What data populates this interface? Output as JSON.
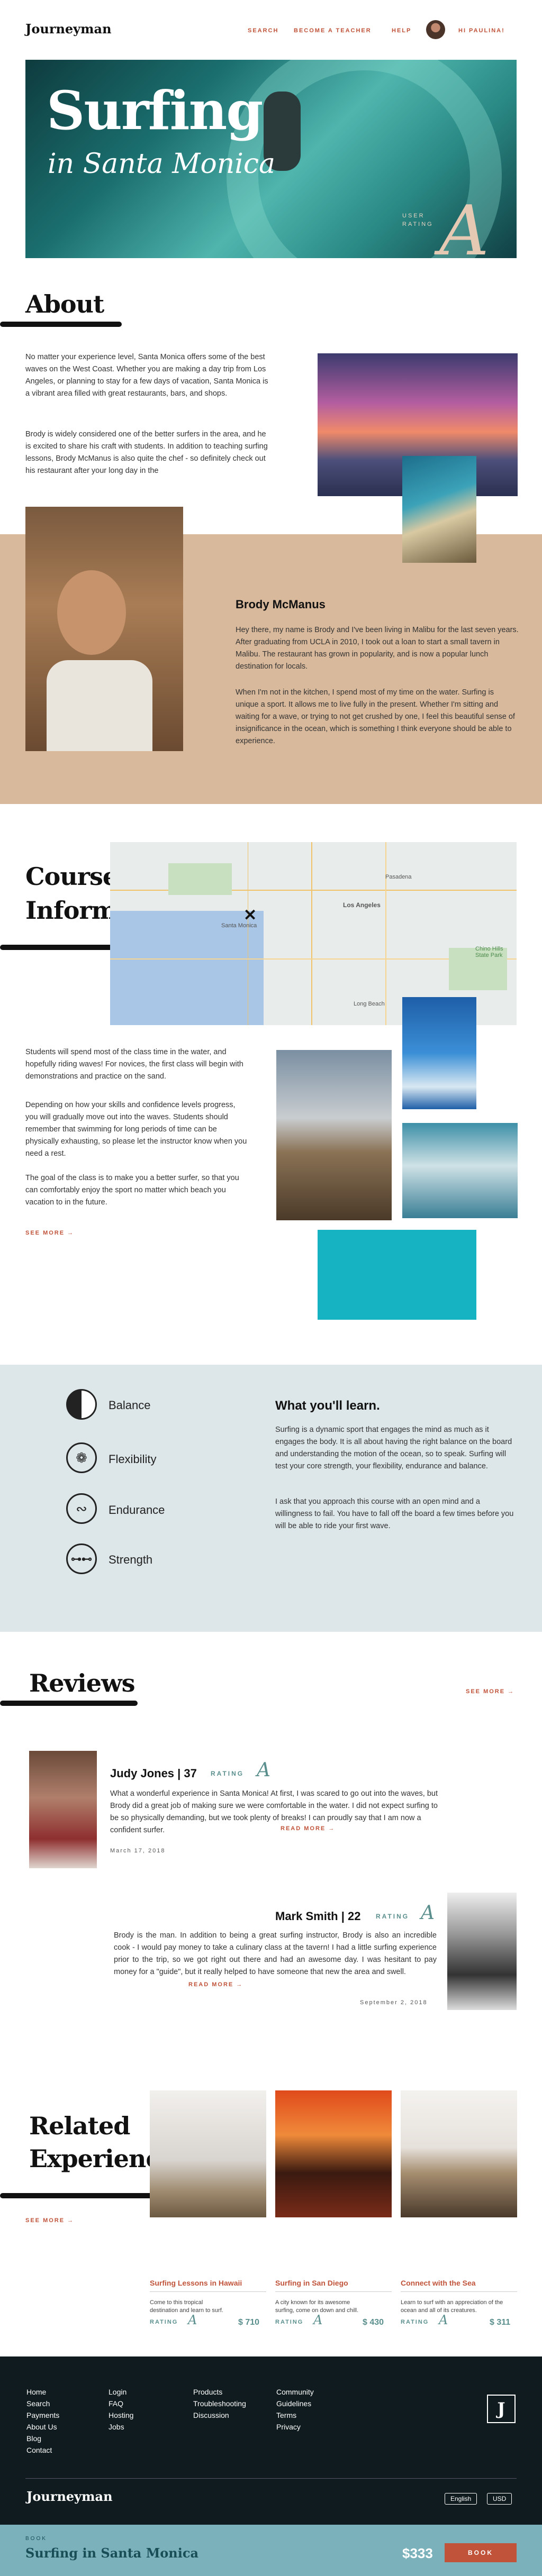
{
  "header": {
    "logo": "Journeyman",
    "nav": [
      "SEARCH",
      "BECOME A TEACHER",
      "HELP"
    ],
    "greeting": "HI PAULINA!"
  },
  "hero": {
    "title": "Surfing",
    "subtitle": "in Santa Monica",
    "rating_label": "USER\nRATING",
    "rating_value": "A"
  },
  "about": {
    "heading": "About",
    "p1": "No matter your experience level, Santa Monica offers some of the best waves on the West Coast. Whether you are making a day trip from Los Angeles, or planning to stay for a few days of vacation, Santa Monica is a vibrant area filled with great restaurants, bars, and shops.",
    "p2": "Brody is widely considered one of the better surfers in the area, and he is excited to share his craft with students. In addition to teaching surfing lessons, Brody McManus is also quite the chef - so definitely check out his restaurant after your long day in the"
  },
  "instructor": {
    "name": "Brody McManus",
    "p1": "Hey there, my name is Brody and I've been living in Malibu for the last seven years. After graduating from UCLA in 2010, I took out a loan to start a small tavern in Malibu. The restaurant has grown in popularity, and is now a popular lunch destination for locals.",
    "p2": "When I'm not in the kitchen, I spend most of my time on the water. Surfing is unique a sport. It allows me to live fully in the present. Whether I'm sitting and waiting for a wave, or trying to not get crushed by one, I feel this beautiful sense of insignificance in the ocean, which is something I think everyone should be able to experience."
  },
  "course": {
    "heading1": "Course",
    "heading2": "Information",
    "map_labels": [
      "Santa Monica",
      "Los Angeles",
      "Long Beach",
      "Chino Hills State Park",
      "Pasadena"
    ],
    "p1": "Students will spend most of the class time in the water, and hopefully riding waves! For novices, the first class will begin with demonstrations and practice on the sand.",
    "p2": "Depending on how your skills and confidence levels progress, you will gradually move out into the waves. Students should remember that swimming for long periods of time can be physically exhausting, so please let the instructor know when you need a rest.",
    "p3": "The goal of the class is to make you a better surfer, so that you can comfortably enjoy the sport no matter which beach you vacation to in the future.",
    "see_more": "SEE MORE →"
  },
  "learn": {
    "skills": [
      "Balance",
      "Flexibility",
      "Endurance",
      "Strength"
    ],
    "heading": "What you'll learn.",
    "p1": "Surfing is a dynamic sport that engages the mind as much as it engages the body. It is all about having the right balance on the board and understanding the motion of the ocean, so to speak. Surfing will test your core strength, your flexibility, endurance and balance.",
    "p2": "I ask that you approach this course with an open mind and a willingness to fail. You have to fall off the board a few times before you will be able to ride your first wave."
  },
  "reviews": {
    "heading": "Reviews",
    "see_more": "SEE MORE →",
    "items": [
      {
        "name": "Judy Jones | 37",
        "rating_label": "RATING",
        "rating": "A",
        "text": "What a wonderful experience in Santa Monica! At first, I was scared to go out into the waves, but Brody did a great job of making sure we were comfortable in the water. I did not expect surfing to be so physically demanding, but we took plenty of breaks! I can proudly say that I am now a confident surfer.",
        "read_more": "READ MORE →",
        "date": "March 17, 2018"
      },
      {
        "name": "Mark Smith | 22",
        "rating_label": "RATING",
        "rating": "A",
        "text": "Brody is the man. In addition to being a great surfing instructor, Brody is also an incredible cook - I would pay money to take a culinary class at the tavern! I had a little surfing experience prior to the trip, so we got right out there and had an awesome day. I was hesitant to pay money for a \"guide\", but it really helped to have someone that new the area and swell.",
        "read_more": "READ MORE →",
        "date": "September 2, 2018"
      }
    ]
  },
  "related": {
    "heading1": "Related",
    "heading2": "Experiences",
    "see_more": "SEE MORE →",
    "cards": [
      {
        "title": "Surfing Lessons in Hawaii",
        "desc": "Come to this tropical destination and learn to surf.",
        "rating_label": "RATING",
        "rating": "A",
        "price": "$ 710"
      },
      {
        "title": "Surfing in San Diego",
        "desc": "A city known for its awesome surfing, come on down and chill.",
        "rating_label": "RATING",
        "rating": "A",
        "price": "$ 430"
      },
      {
        "title": "Connect with the Sea",
        "desc": "Learn to surf with an appreciation of the ocean and all of its creatures.",
        "rating_label": "RATING",
        "rating": "A",
        "price": "$ 311"
      }
    ]
  },
  "footer": {
    "col1": [
      "Home",
      "Search",
      "Payments",
      "About Us",
      "Blog",
      "Contact"
    ],
    "col2": [
      "Login",
      "FAQ",
      "Hosting",
      "Jobs"
    ],
    "col3": [
      "Products",
      "Troubleshooting",
      "Discussion"
    ],
    "col4": [
      "Community",
      "Guidelines",
      "Terms",
      "Privacy"
    ],
    "logo": "Journeyman",
    "badge": "J",
    "lang": "English",
    "currency": "USD"
  },
  "booking": {
    "label": "BOOK",
    "title": "Surfing in Santa Monica",
    "price": "$333",
    "button": "BOOK"
  },
  "colors": {
    "accent": "#c0533a",
    "tan": "#d9b99b",
    "mist": "#dde6e8",
    "footer": "#0f1b1e",
    "teal": "#7bb1ba"
  }
}
